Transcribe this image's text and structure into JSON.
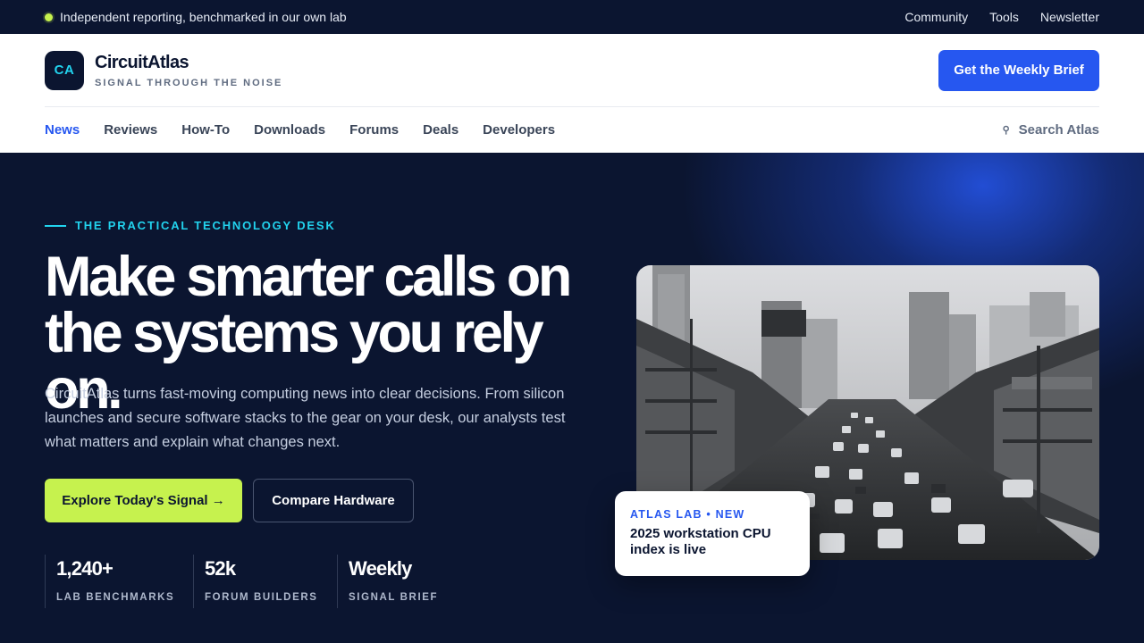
{
  "topbar": {
    "tagline": "Independent reporting, benchmarked in our own lab",
    "links": [
      "Community",
      "Tools",
      "Newsletter"
    ]
  },
  "header": {
    "logo_initials": "CA",
    "brand_name": "CircuitAtlas",
    "brand_tagline": "SIGNAL THROUGH THE NOISE",
    "cta_label": "Get the Weekly Brief"
  },
  "nav": {
    "items": [
      "News",
      "Reviews",
      "How-To",
      "Downloads",
      "Forums",
      "Deals",
      "Developers"
    ],
    "active": "News",
    "search_label": "Search Atlas"
  },
  "hero": {
    "eyebrow": "THE PRACTICAL TECHNOLOGY DESK",
    "headline_line1": "Make smarter calls on",
    "headline_line2": "the systems you rely on.",
    "lede": "CircuitAtlas turns fast-moving computing news into clear decisions. From silicon launches and secure software stacks to the gear on your desk, our analysts test what matters and explain what changes next.",
    "primary_button": "Explore Today's Signal →",
    "secondary_button": "Compare Hardware",
    "stats": [
      {
        "value": "1,240+",
        "label": "LAB BENCHMARKS"
      },
      {
        "value": "52k",
        "label": "FORUM BUILDERS"
      },
      {
        "value": "Weekly",
        "label": "SIGNAL BRIEF"
      }
    ],
    "card": {
      "tag": "ATLAS LAB • NEW",
      "title": "2025 workstation CPU index is live"
    }
  },
  "colors": {
    "navy": "#0b1530",
    "accent_blue": "#2657f0",
    "lime": "#c6f24e",
    "cyan": "#22d3ee"
  },
  "icons": {
    "search": "search-icon",
    "status_dot": "status-dot-icon"
  }
}
